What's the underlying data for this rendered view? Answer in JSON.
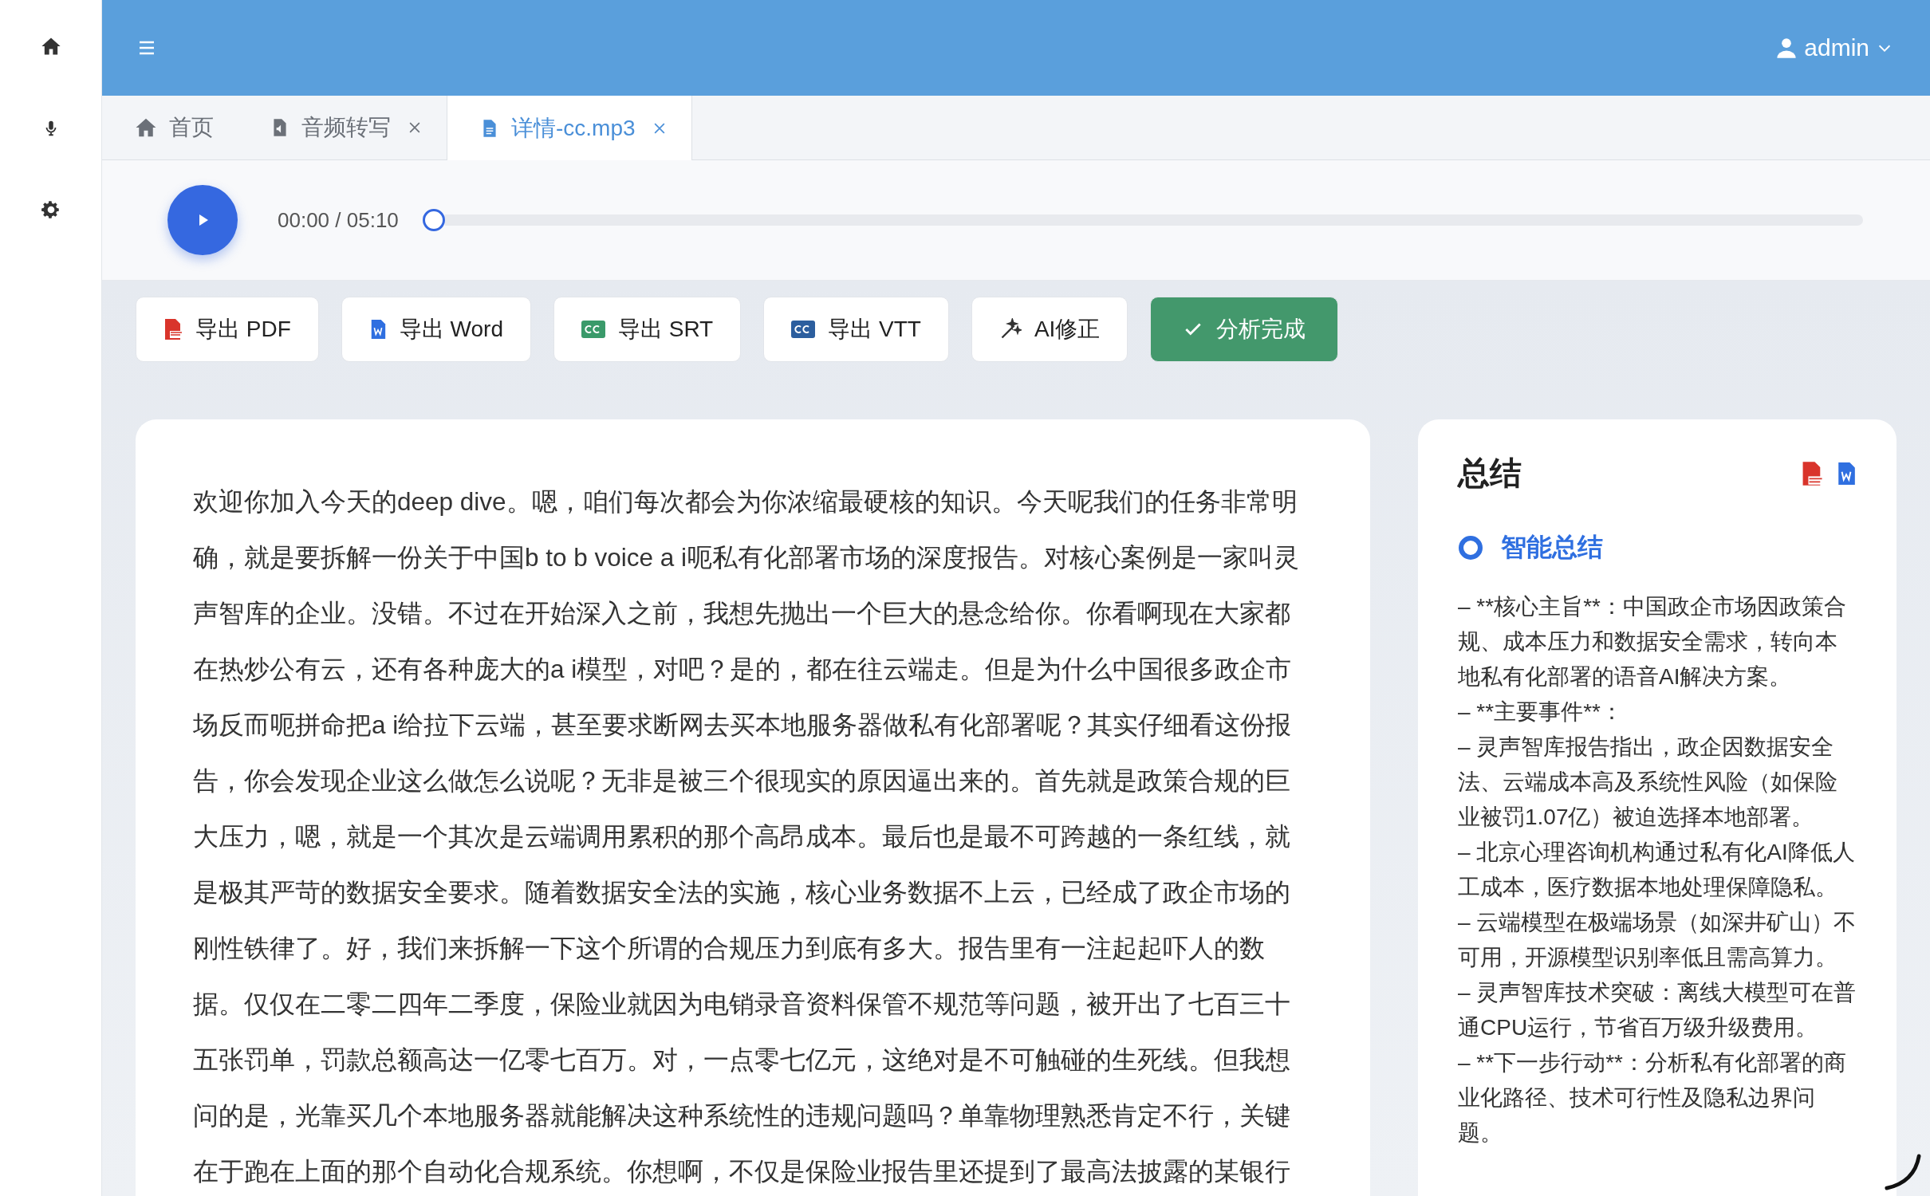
{
  "sidebar": {
    "items": [
      {
        "kind": "home",
        "selected": false
      },
      {
        "kind": "mic",
        "selected": false
      },
      {
        "kind": "settings",
        "selected": false
      }
    ]
  },
  "header": {
    "user": "admin"
  },
  "tabs": [
    {
      "label": "首页",
      "kind": "home",
      "closable": false,
      "selected": false
    },
    {
      "label": "音频转写",
      "kind": "audio",
      "closable": true,
      "selected": false
    },
    {
      "label": "详情-cc.mp3",
      "kind": "file",
      "closable": true,
      "selected": true
    }
  ],
  "player": {
    "time": "00:00 / 05:10",
    "level": 0
  },
  "actions": [
    {
      "label": "导出 PDF",
      "kind": "pdf"
    },
    {
      "label": "导出 Word",
      "kind": "word"
    },
    {
      "label": "导出 SRT",
      "kind": "srt"
    },
    {
      "label": "导出 VTT",
      "kind": "vtt"
    },
    {
      "label": "AI修正",
      "kind": "magic"
    },
    {
      "label": "分析完成",
      "kind": "done"
    }
  ],
  "transcript": "欢迎你加入今天的deep dive。嗯，咱们每次都会为你浓缩最硬核的知识。今天呢我们的任务非常明确，就是要拆解一份关于中国b to b voice a i呃私有化部署市场的深度报告。对核心案例是一家叫灵声智库的企业。没错。不过在开始深入之前，我想先抛出一个巨大的悬念给你。你看啊现在大家都在热炒公有云，还有各种庞大的a i模型，对吧？是的，都在往云端走。但是为什么中国很多政企市场反而呃拼命把a i给拉下云端，甚至要求断网去买本地服务器做私有化部署呢？其实仔细看这份报告，你会发现企业这么做怎么说呢？无非是被三个很现实的原因逼出来的。首先就是政策合规的巨大压力，嗯，就是一个其次是云端调用累积的那个高昂成本。最后也是最不可跨越的一条红线，就是极其严苛的数据安全要求。随着数据安全法的实施，核心业务数据不上云，已经成了政企市场的刚性铁律了。好，我们来拆解一下这个所谓的合规压力到底有多大。报告里有一注起起吓人的数据。仅仅在二零二四年二季度，保险业就因为电销录音资料保管不规范等问题，被开出了七百三十五张罚单，罚款总额高达一亿零七百万。对，一点零七亿元，这绝对是不可触碰的生死线。但我想问的是，光靠买几个本地服务器就能解决这种系统性的违规问题吗？单靠物理熟悉肯定不行，关键在于跑在上面的那个自动化合规系统。你想啊，不仅是保险业报告里还提到了最高法披露的某银行",
  "summary": {
    "title": "总结",
    "section": "智能总结",
    "lines": [
      "– **核心主旨**：中国政企市场因政策合规、成本压力和数据安全需求，转向本地私有化部署的语音AI解决方案。",
      "– **主要事件**：",
      "– 灵声智库报告指出，政企因数据安全法、云端成本高及系统性风险（如保险业被罚1.07亿）被迫选择本地部署。",
      "– 北京心理咨询机构通过私有化AI降低人工成本，医疗数据本地处理保障隐私。",
      "– 云端模型在极端场景（如深井矿山）不可用，开源模型识别率低且需高算力。",
      "– 灵声智库技术突破：离线大模型可在普通CPU运行，节省百万级升级费用。",
      "– **下一步行动**：分析私有化部署的商业化路径、技术可行性及隐私边界问题。"
    ]
  }
}
